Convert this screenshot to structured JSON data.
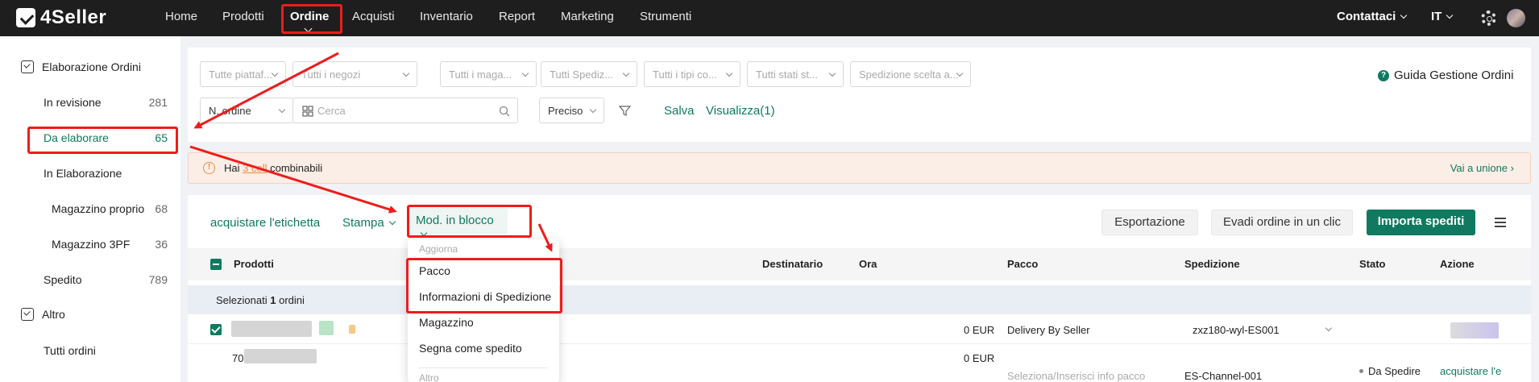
{
  "app": {
    "name": "4Seller"
  },
  "nav": {
    "items": [
      "Home",
      "Prodotti",
      "Ordine",
      "Acquisti",
      "Inventario",
      "Report",
      "Marketing",
      "Strumenti"
    ],
    "contact": "Contattaci",
    "language": "IT"
  },
  "sidebar": {
    "section1": "Elaborazione Ordini",
    "items": [
      {
        "label": "In revisione",
        "count": "281"
      },
      {
        "label": "Da elaborare",
        "count": "65"
      },
      {
        "label": "In Elaborazione",
        "count": ""
      },
      {
        "label": "Magazzino proprio",
        "count": "68"
      },
      {
        "label": "Magazzino 3PF",
        "count": "36"
      },
      {
        "label": "Spedito",
        "count": "789"
      }
    ],
    "section2": "Altro",
    "other": "Tutti ordini"
  },
  "filters": {
    "row1": [
      "Tutte piattaf...",
      "Tutti i negozi",
      "Tutti i maga...",
      "Tutti Spediz...",
      "Tutti i tipi co...",
      "Tutti stati st...",
      "Spedizione scelta a..."
    ],
    "order_type": "N. ordine",
    "search_placeholder": "Cerca",
    "match": "Preciso",
    "save": "Salva",
    "view": "Visualizza(1)",
    "help": "Guida Gestione Ordini"
  },
  "notice": {
    "prefix": "Hai",
    "link": "3 coll",
    "suffix": "combinabili",
    "action": "Vai a unione"
  },
  "toolbar": {
    "label_purchase": "acquistare l'etichetta",
    "print": "Stampa",
    "bulk_edit": "Mod. in blocco",
    "export": "Esportazione",
    "one_click": "Evadi ordine in un clic",
    "import": "Importa spediti"
  },
  "table": {
    "headers": {
      "products": "Prodotti",
      "recipient": "Destinatario",
      "time": "Ora",
      "package": "Pacco",
      "shipping": "Spedizione",
      "status": "Stato",
      "action": "Azione"
    },
    "selected_prefix": "Selezionati",
    "selected_count": "1",
    "selected_suffix": "ordini",
    "rows": [
      {
        "amount": "0 EUR",
        "package": "Delivery By Seller",
        "shipping": "zxz180-wyl-ES001"
      },
      {
        "id_prefix": "70",
        "amount": "0 EUR",
        "package": "Seleziona/Inserisci info pacco",
        "shipping": "ES-Channel-001",
        "status": "Da Spedire",
        "action": "acquistare l'e"
      }
    ]
  },
  "dropdown": {
    "group1": "Aggiorna",
    "items": [
      "Pacco",
      "Informazioni di Spedizione",
      "Magazzino",
      "Segna come spedito"
    ],
    "group2": "Altro"
  }
}
